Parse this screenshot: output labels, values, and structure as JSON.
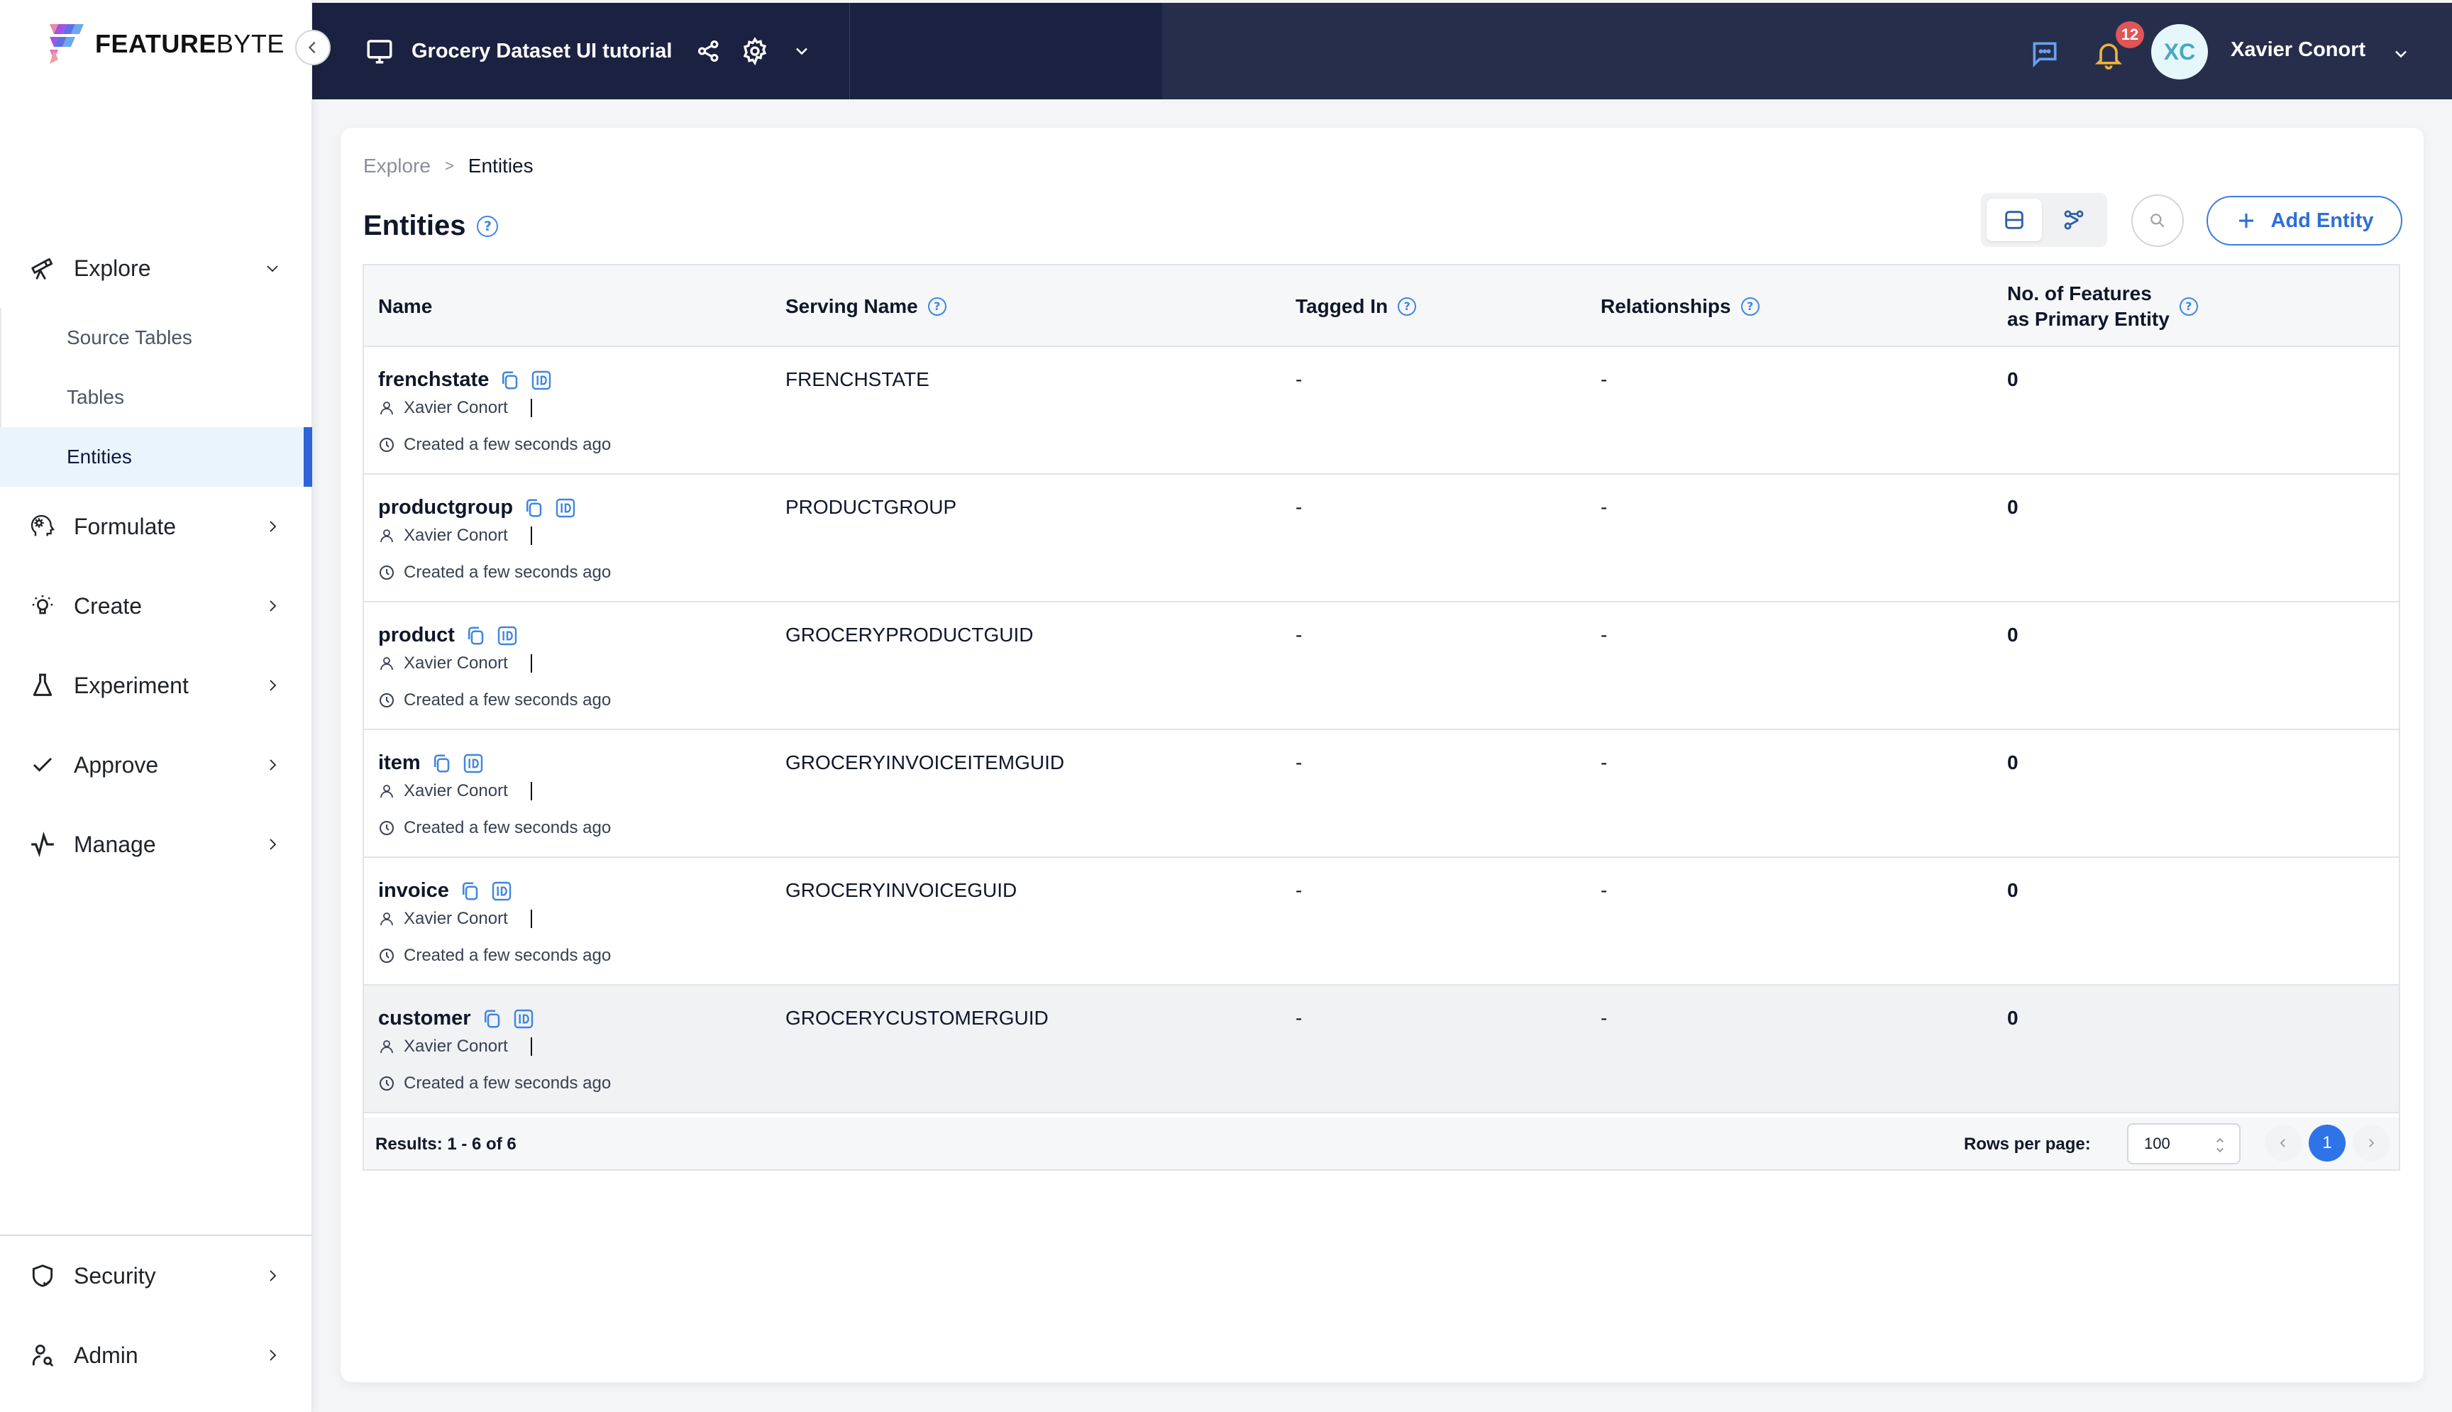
{
  "app": {
    "logo_bold": "FEATURE",
    "logo_light": "BYTE"
  },
  "topbar": {
    "project_title": "Grocery Dataset UI tutorial",
    "notification_count": "12",
    "user_initials": "XC",
    "user_name": "Xavier Conort"
  },
  "sidebar": {
    "explore": {
      "label": "Explore",
      "children": [
        {
          "label": "Source Tables"
        },
        {
          "label": "Tables"
        },
        {
          "label": "Entities",
          "active": true
        }
      ]
    },
    "items": [
      {
        "label": "Formulate",
        "icon": "brain-gear-icon"
      },
      {
        "label": "Create",
        "icon": "lightbulb-icon"
      },
      {
        "label": "Experiment",
        "icon": "flask-icon"
      },
      {
        "label": "Approve",
        "icon": "check-icon"
      },
      {
        "label": "Manage",
        "icon": "pulse-icon"
      }
    ],
    "bottom_items": [
      {
        "label": "Security",
        "icon": "shield-icon"
      },
      {
        "label": "Admin",
        "icon": "user-search-icon"
      }
    ]
  },
  "breadcrumb": {
    "parent": "Explore",
    "separator": ">",
    "current": "Entities"
  },
  "page": {
    "title": "Entities",
    "add_button": "Add Entity",
    "help_glyph": "?"
  },
  "table": {
    "columns": [
      {
        "label": "Name"
      },
      {
        "label": "Serving Name"
      },
      {
        "label": "Tagged In"
      },
      {
        "label": "Relationships"
      },
      {
        "label_line1": "No. of Features",
        "label_line2": "as Primary Entity"
      }
    ],
    "rows": [
      {
        "name": "frenchstate",
        "owner": "Xavier Conort",
        "created": "Created a few seconds ago",
        "serving_name": "FRENCHSTATE",
        "tagged_in": "-",
        "relationships": "-",
        "num_features": "0"
      },
      {
        "name": "productgroup",
        "owner": "Xavier Conort",
        "created": "Created a few seconds ago",
        "serving_name": "PRODUCTGROUP",
        "tagged_in": "-",
        "relationships": "-",
        "num_features": "0"
      },
      {
        "name": "product",
        "owner": "Xavier Conort",
        "created": "Created a few seconds ago",
        "serving_name": "GROCERYPRODUCTGUID",
        "tagged_in": "-",
        "relationships": "-",
        "num_features": "0"
      },
      {
        "name": "item",
        "owner": "Xavier Conort",
        "created": "Created a few seconds ago",
        "serving_name": "GROCERYINVOICEITEMGUID",
        "tagged_in": "-",
        "relationships": "-",
        "num_features": "0"
      },
      {
        "name": "invoice",
        "owner": "Xavier Conort",
        "created": "Created a few seconds ago",
        "serving_name": "GROCERYINVOICEGUID",
        "tagged_in": "-",
        "relationships": "-",
        "num_features": "0"
      },
      {
        "name": "customer",
        "owner": "Xavier Conort",
        "created": "Created a few seconds ago",
        "serving_name": "GROCERYCUSTOMERGUID",
        "tagged_in": "-",
        "relationships": "-",
        "num_features": "0"
      }
    ],
    "footer": {
      "results": "Results: 1 - 6 of 6",
      "rows_per_page_label": "Rows per page:",
      "rows_per_page_value": "100",
      "current_page": "1"
    }
  },
  "colors": {
    "accent": "#2f74e6",
    "topbar": "#1b2140",
    "badge": "#e05555",
    "active_nav_bg": "#eaf4fd"
  }
}
